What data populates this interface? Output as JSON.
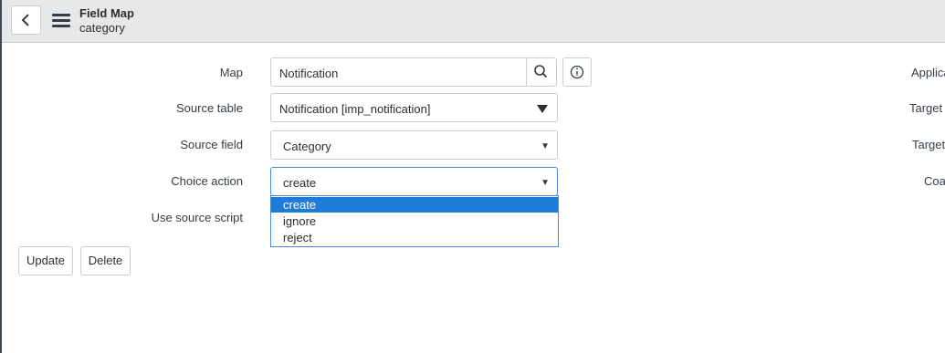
{
  "header": {
    "title": "Field Map",
    "subtitle": "category"
  },
  "form": {
    "map": {
      "label": "Map",
      "value": "Notification"
    },
    "source_table": {
      "label": "Source table",
      "value": "Notification [imp_notification]"
    },
    "source_field": {
      "label": "Source field",
      "value": "Category"
    },
    "choice_action": {
      "label": "Choice action",
      "value": "create",
      "options": [
        "create",
        "ignore",
        "reject"
      ]
    },
    "use_source_script": {
      "label": "Use source script"
    }
  },
  "right_column": {
    "applica_label": "Applica",
    "target_t_label": "Target t",
    "target_label": "Target",
    "coal_label": "Coal"
  },
  "buttons": {
    "update": "Update",
    "delete": "Delete"
  },
  "icons": {
    "back": "chevron-left-icon",
    "menu": "hamburger-menu-icon",
    "search": "search-icon",
    "info": "info-icon"
  },
  "colors": {
    "header_bg": "#e6e8ea",
    "selected_option": "#1e7bd7",
    "focus_border": "#4a8bd0"
  }
}
